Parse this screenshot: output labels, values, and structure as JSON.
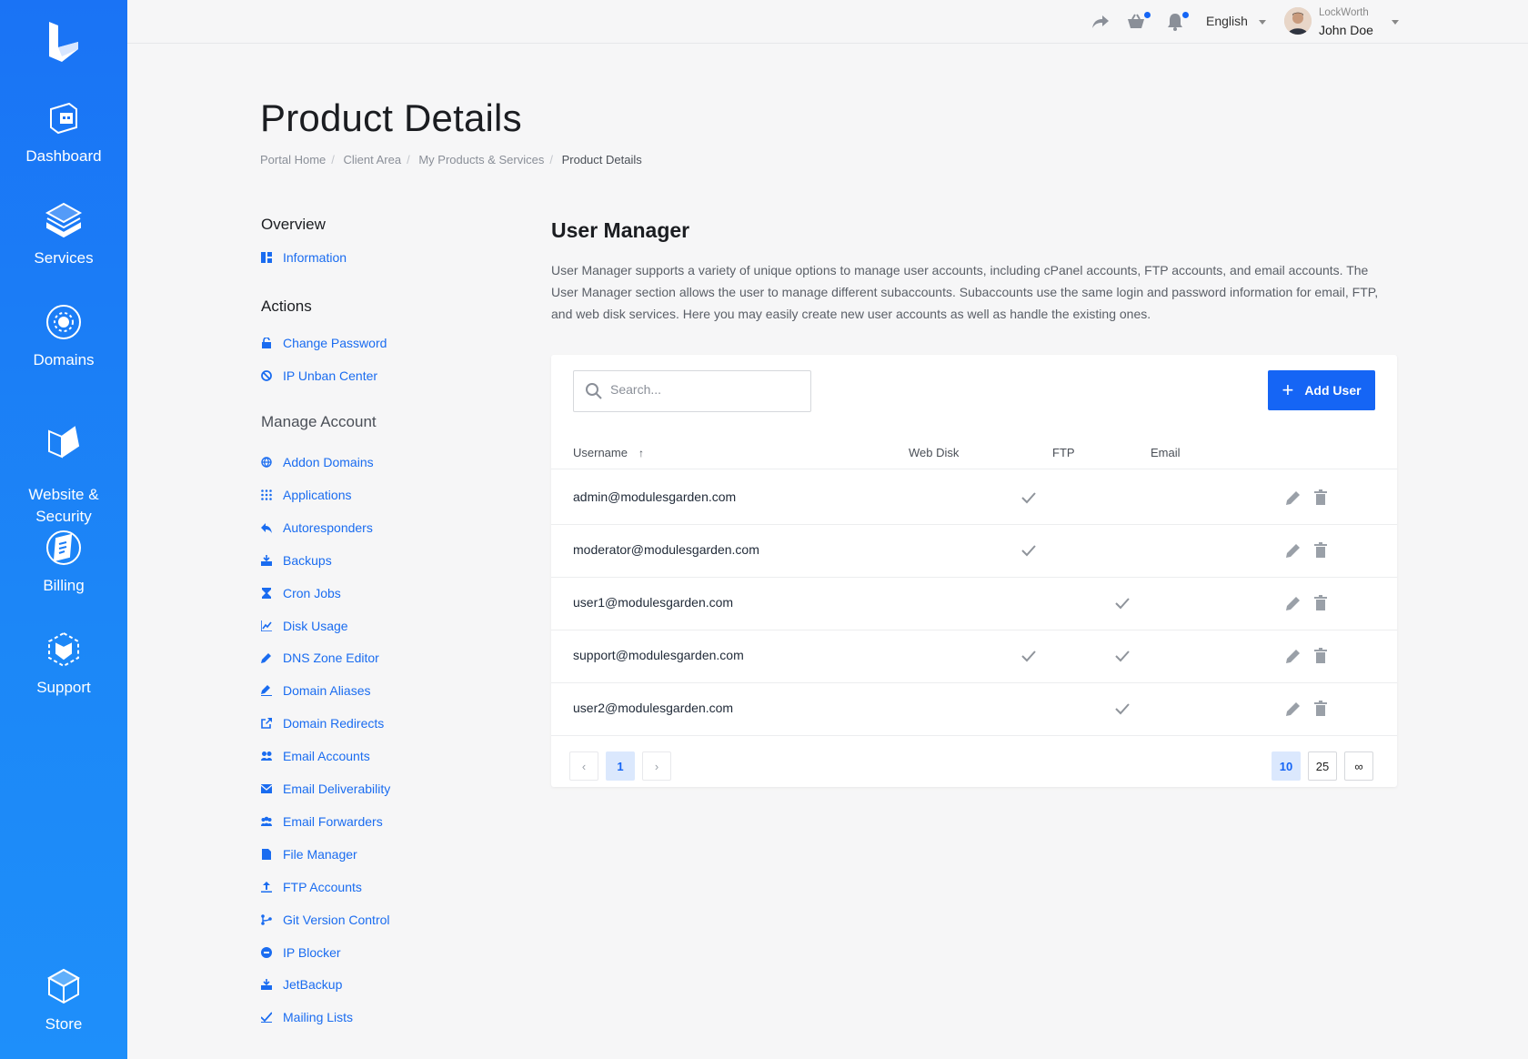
{
  "sidebar": {
    "items": [
      {
        "label": "Dashboard",
        "icon": "dashboard-icon"
      },
      {
        "label": "Services",
        "icon": "services-icon"
      },
      {
        "label": "Domains",
        "icon": "domains-icon"
      },
      {
        "label": "Website &\nSecurity",
        "icon": "website-security-icon"
      },
      {
        "label": "Billing",
        "icon": "billing-icon"
      },
      {
        "label": "Support",
        "icon": "support-icon"
      },
      {
        "label": "Store",
        "icon": "store-icon"
      }
    ]
  },
  "topbar": {
    "language": "English",
    "user_company": "LockWorth",
    "user_name": "John Doe"
  },
  "page": {
    "title": "Product Details",
    "breadcrumb": [
      "Portal Home",
      "Client Area",
      "My Products & Services",
      "Product Details"
    ]
  },
  "menu": {
    "overview_heading": "Overview",
    "overview_items": [
      {
        "label": "Information",
        "icon": "information-icon"
      }
    ],
    "actions_heading": "Actions",
    "actions_items": [
      {
        "label": "Change Password",
        "icon": "lock-icon"
      },
      {
        "label": "IP Unban Center",
        "icon": "ban-icon"
      }
    ],
    "manage_heading": "Manage Account",
    "manage_items": [
      {
        "label": "Addon Domains",
        "icon": "globe-icon"
      },
      {
        "label": "Applications",
        "icon": "grid-icon"
      },
      {
        "label": "Autoresponders",
        "icon": "reply-icon"
      },
      {
        "label": "Backups",
        "icon": "backup-icon"
      },
      {
        "label": "Cron Jobs",
        "icon": "hourglass-icon"
      },
      {
        "label": "Disk Usage",
        "icon": "chart-icon"
      },
      {
        "label": "DNS Zone Editor",
        "icon": "pencil-icon"
      },
      {
        "label": "Domain Aliases",
        "icon": "alias-icon"
      },
      {
        "label": "Domain Redirects",
        "icon": "external-link-icon"
      },
      {
        "label": "Email Accounts",
        "icon": "users-icon"
      },
      {
        "label": "Email Deliverability",
        "icon": "envelope-icon"
      },
      {
        "label": "Email Forwarders",
        "icon": "group-icon"
      },
      {
        "label": "File Manager",
        "icon": "file-icon"
      },
      {
        "label": "FTP Accounts",
        "icon": "upload-icon"
      },
      {
        "label": "Git Version Control",
        "icon": "git-icon"
      },
      {
        "label": "IP Blocker",
        "icon": "minus-circle-icon"
      },
      {
        "label": "JetBackup",
        "icon": "backup-icon"
      },
      {
        "label": "Mailing Lists",
        "icon": "check-icon"
      }
    ]
  },
  "user_manager": {
    "title": "User Manager",
    "description": "User Manager supports a variety of unique options to manage user accounts, including cPanel accounts, FTP accounts, and email accounts. The User Manager section allows the user to manage different subaccounts. Subaccounts use the same login and password information for email, FTP, and web disk services. Here you may easily create new user accounts as well as handle the existing ones.",
    "search_placeholder": "Search...",
    "add_button": "Add User",
    "columns": [
      "Username",
      "Web Disk",
      "FTP",
      "Email"
    ],
    "rows": [
      {
        "username": "admin@modulesgarden.com",
        "webdisk": false,
        "ftp": true,
        "email": false
      },
      {
        "username": "moderator@modulesgarden.com",
        "webdisk": false,
        "ftp": true,
        "email": false
      },
      {
        "username": "user1@modulesgarden.com",
        "webdisk": false,
        "ftp": false,
        "email": true
      },
      {
        "username": "support@modulesgarden.com",
        "webdisk": false,
        "ftp": true,
        "email": true
      },
      {
        "username": "user2@modulesgarden.com",
        "webdisk": false,
        "ftp": false,
        "email": true
      }
    ],
    "pagination": {
      "prev": "‹",
      "current_page": "1",
      "next": "›",
      "page_sizes": [
        "10",
        "25",
        "∞"
      ],
      "active_size": "10"
    }
  },
  "colors": {
    "accent": "#1565f5",
    "sidebar": "#1a7cf6",
    "link": "#1a6cf0"
  }
}
